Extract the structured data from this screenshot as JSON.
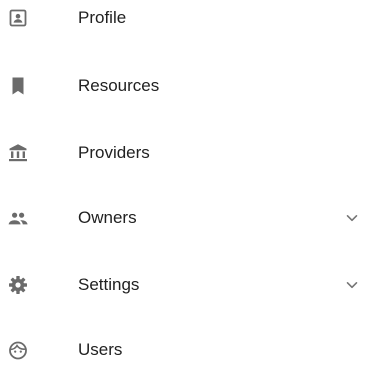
{
  "colors": {
    "icon": "#6b6b6b",
    "text": "#212121",
    "chevron": "#757575"
  },
  "nav": {
    "items": [
      {
        "label": "Profile",
        "icon": "account-box-icon",
        "expandable": false
      },
      {
        "label": "Resources",
        "icon": "bookmark-icon",
        "expandable": false
      },
      {
        "label": "Providers",
        "icon": "bank-icon",
        "expandable": false
      },
      {
        "label": "Owners",
        "icon": "people-icon",
        "expandable": true
      },
      {
        "label": "Settings",
        "icon": "gear-icon",
        "expandable": true
      },
      {
        "label": "Users",
        "icon": "face-icon",
        "expandable": false
      }
    ]
  }
}
